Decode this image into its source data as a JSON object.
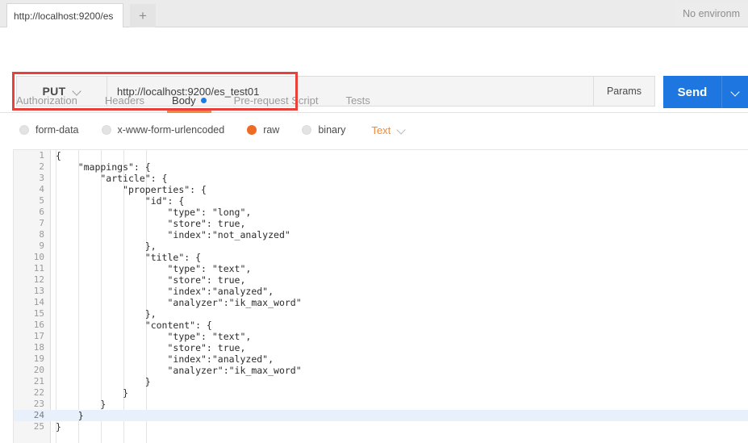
{
  "window": {
    "tab_label": "http://localhost:9200/es",
    "new_tab_icon": "plus-icon",
    "environment_label": "No environm"
  },
  "request": {
    "method": "PUT",
    "method_caret_icon": "chevron-down-icon",
    "url": "http://localhost:9200/es_test01",
    "params_label": "Params",
    "send_label": "Send",
    "send_caret_icon": "chevron-down-icon",
    "highlight_color": "#e8413c"
  },
  "subtabs": [
    {
      "label": "Authorization",
      "active": false,
      "dot": false
    },
    {
      "label": "Headers",
      "active": false,
      "dot": false
    },
    {
      "label": "Body",
      "active": true,
      "dot": true
    },
    {
      "label": "Pre-request Script",
      "active": false,
      "dot": false
    },
    {
      "label": "Tests",
      "active": false,
      "dot": false
    }
  ],
  "body_types": [
    {
      "label": "form-data",
      "selected": false
    },
    {
      "label": "x-www-form-urlencoded",
      "selected": false
    },
    {
      "label": "raw",
      "selected": true
    },
    {
      "label": "binary",
      "selected": false
    }
  ],
  "body_format": {
    "label": "Text",
    "caret_icon": "chevron-down-icon",
    "accent_color": "#ef8b39"
  },
  "editor": {
    "active_line": 24,
    "lines": [
      {
        "n": 1,
        "text": "{"
      },
      {
        "n": 2,
        "text": "    \"mappings\": {"
      },
      {
        "n": 3,
        "text": "        \"article\": {"
      },
      {
        "n": 4,
        "text": "            \"properties\": {"
      },
      {
        "n": 5,
        "text": "                \"id\": {"
      },
      {
        "n": 6,
        "text": "                    \"type\": \"long\","
      },
      {
        "n": 7,
        "text": "                    \"store\": true,"
      },
      {
        "n": 8,
        "text": "                    \"index\":\"not_analyzed\""
      },
      {
        "n": 9,
        "text": "                },"
      },
      {
        "n": 10,
        "text": "                \"title\": {"
      },
      {
        "n": 11,
        "text": "                    \"type\": \"text\","
      },
      {
        "n": 12,
        "text": "                    \"store\": true,"
      },
      {
        "n": 13,
        "text": "                    \"index\":\"analyzed\","
      },
      {
        "n": 14,
        "text": "                    \"analyzer\":\"ik_max_word\""
      },
      {
        "n": 15,
        "text": "                },"
      },
      {
        "n": 16,
        "text": "                \"content\": {"
      },
      {
        "n": 17,
        "text": "                    \"type\": \"text\","
      },
      {
        "n": 18,
        "text": "                    \"store\": true,"
      },
      {
        "n": 19,
        "text": "                    \"index\":\"analyzed\","
      },
      {
        "n": 20,
        "text": "                    \"analyzer\":\"ik_max_word\""
      },
      {
        "n": 21,
        "text": "                }"
      },
      {
        "n": 22,
        "text": "            }"
      },
      {
        "n": 23,
        "text": "        }"
      },
      {
        "n": 24,
        "text": "    }"
      },
      {
        "n": 25,
        "text": "}"
      }
    ]
  }
}
